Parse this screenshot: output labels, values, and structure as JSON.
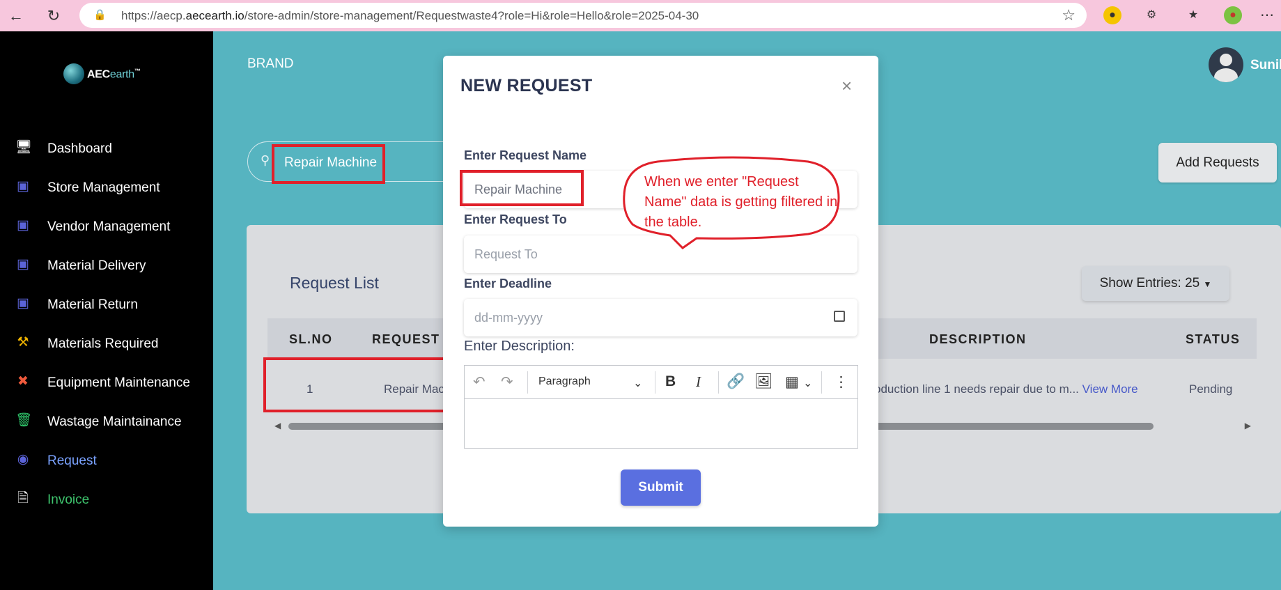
{
  "browser": {
    "url_prefix": "https://aecp.",
    "url_domain": "aecearth.io",
    "url_path": "/store-admin/store-management/Requestwaste4?role=Hi&role=Hello&role=2025-04-30"
  },
  "sidebar": {
    "logo_text_a": "AEC",
    "logo_text_b": "earth",
    "logo_tm": "™",
    "items": [
      {
        "label": "Dashboard",
        "icon": "monitor-icon",
        "color": "#ffffff"
      },
      {
        "label": "Store Management",
        "icon": "store-icon",
        "color": "#ffffff"
      },
      {
        "label": "Vendor Management",
        "icon": "store-icon",
        "color": "#ffffff"
      },
      {
        "label": "Material Delivery",
        "icon": "store-icon",
        "color": "#ffffff"
      },
      {
        "label": "Material Return",
        "icon": "store-icon",
        "color": "#ffffff"
      },
      {
        "label": "Materials Required",
        "icon": "hammer-icon",
        "color": "#ffffff"
      },
      {
        "label": "Equipment Maintenance",
        "icon": "tools-icon",
        "color": "#ffffff"
      },
      {
        "label": "Wastage Maintainance",
        "icon": "trash-icon",
        "color": "#ffffff"
      },
      {
        "label": "Request",
        "icon": "request-icon",
        "color": "#7aa2ff"
      },
      {
        "label": "Invoice",
        "icon": "document-icon",
        "color": "#3ec46d"
      }
    ]
  },
  "header": {
    "brand": "BRAND",
    "user_name": "Sunil"
  },
  "search": {
    "value": "Repair Machine"
  },
  "actions": {
    "add_requests": "Add Requests"
  },
  "request_list": {
    "title": "Request List",
    "show_entries": "Show Entries: 25",
    "columns": [
      "SL.NO",
      "REQUEST N",
      "DESCRIPTION",
      "STATUS"
    ],
    "rows": [
      {
        "sl_no": "1",
        "request_name": "Repair Mac",
        "description": "oduction line 1 needs repair due to m...",
        "view_more": "View More",
        "status": "Pending"
      }
    ]
  },
  "modal": {
    "title": "NEW REQUEST",
    "close": "×",
    "request_name_label": "Enter Request Name",
    "request_name_value": "Repair Machine",
    "request_to_label": "Enter Request To",
    "request_to_placeholder": "Request To",
    "deadline_label": "Enter Deadline",
    "deadline_placeholder": "dd-mm-yyyy",
    "description_label": "Enter Description:",
    "paragraph_select": "Paragraph",
    "submit": "Submit"
  },
  "annotation": {
    "text": "When we enter \"Request Name\" data is getting filtered in the table.",
    "color": "#e0202a"
  },
  "colors": {
    "page_bg": "#56b4c0",
    "sidebar_bg": "#000000",
    "browser_bar": "#f7c7dd",
    "submit_bg": "#5a6fe0",
    "highlight_red": "#e0202a"
  }
}
